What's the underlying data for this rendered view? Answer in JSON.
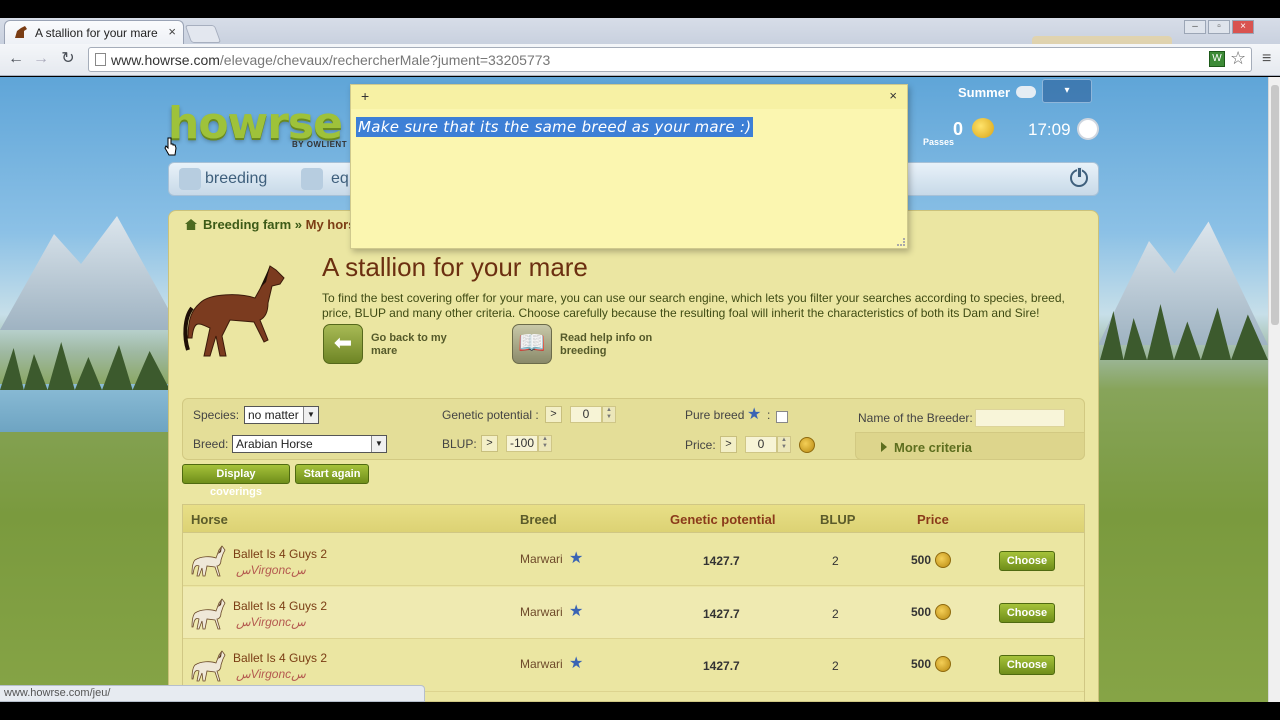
{
  "browser": {
    "tab_title": "A stallion for your mare",
    "url_host": "www.howrse.com",
    "url_path": "/elevage/chevaux/rechercherMale?jument=33205773",
    "status_text": "www.howrse.com/jeu/"
  },
  "header": {
    "logo": "howrse",
    "logo_sub": "BY OWLIENT",
    "season": "Summer",
    "passes_value": "0",
    "passes_label": "Passes",
    "time": "17:09"
  },
  "nav": {
    "items": [
      {
        "label": "breeding"
      },
      {
        "label": "eq"
      }
    ]
  },
  "breadcrumb": {
    "root": "Breeding farm",
    "sep": " » ",
    "current": "My hors"
  },
  "page": {
    "title": "A stallion for your mare",
    "intro": "To find the best covering offer for your mare, you can use our search engine, which lets you filter your searches according to species, breed, price, BLUP and many other criteria. Choose carefully because the resulting foal will inherit the characteristics of both its Dam and Sire!",
    "action_back": "Go back to my mare",
    "action_help": "Read help info on breeding"
  },
  "filters": {
    "species_label": "Species:",
    "species_value": "no matter",
    "breed_label": "Breed:",
    "breed_value": "Arabian Horse",
    "gp_label": "Genetic potential :",
    "gp_op": ">",
    "gp_value": "0",
    "blup_label": "BLUP:",
    "blup_op": ">",
    "blup_value": "-100",
    "pure_label": "Pure breed",
    "pure_colon": ":",
    "price_label": "Price:",
    "price_op": ">",
    "price_value": "0",
    "breeder_label": "Name of the Breeder:",
    "breeder_value": "",
    "more_criteria": "More criteria",
    "display_btn": "Display coverings",
    "reset_btn": "Start again"
  },
  "table": {
    "headers": {
      "horse": "Horse",
      "breed": "Breed",
      "gp": "Genetic potential",
      "blup": "BLUP",
      "price": "Price"
    },
    "rows": [
      {
        "name": "Ballet Is 4 Guys 2",
        "owner": "سVirgoncس",
        "breed": "Marwari",
        "gp": "1427.7",
        "blup": "2",
        "price": "500",
        "action": "Choose"
      },
      {
        "name": "Ballet Is 4 Guys 2",
        "owner": "سVirgoncس",
        "breed": "Marwari",
        "gp": "1427.7",
        "blup": "2",
        "price": "500",
        "action": "Choose"
      },
      {
        "name": "Ballet Is 4 Guys 2",
        "owner": "سVirgoncس",
        "breed": "Marwari",
        "gp": "1427.7",
        "blup": "2",
        "price": "500",
        "action": "Choose"
      }
    ]
  },
  "sticky_note": {
    "plus": "+",
    "close": "×",
    "text": "Make sure that its the same breed as your mare :)"
  },
  "colors": {
    "accent_green": "#8aa82a",
    "panel_bg": "#ebe6a2",
    "title_brown": "#6b2f10",
    "note_yellow": "#fbf6b0",
    "selection_blue": "#3d7fd6"
  }
}
